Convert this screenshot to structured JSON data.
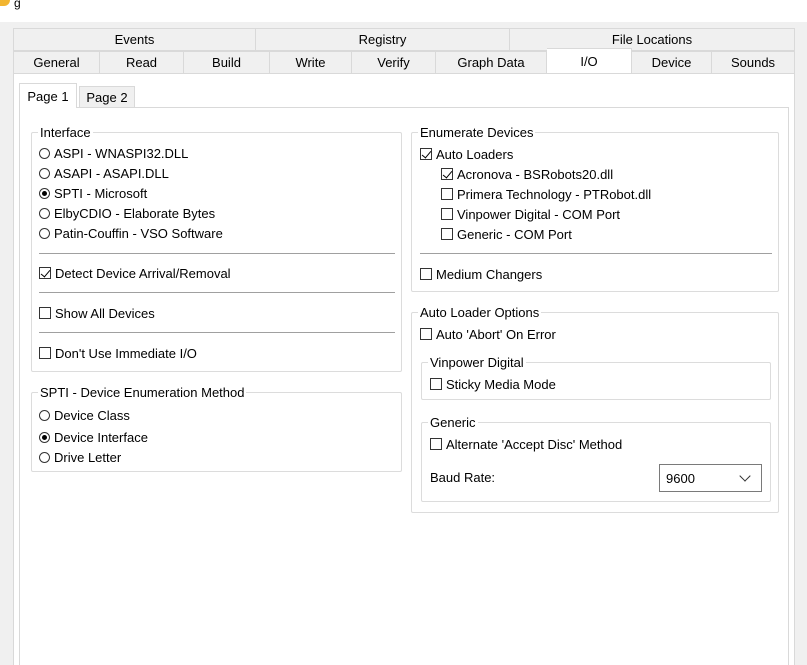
{
  "window": {
    "title_fragment": "g"
  },
  "tabs": {
    "row1": [
      "Events",
      "Registry",
      "File Locations"
    ],
    "row2": [
      "General",
      "Read",
      "Build",
      "Write",
      "Verify",
      "Graph Data",
      "I/O",
      "Device",
      "Sounds"
    ],
    "active": "I/O"
  },
  "subtabs": {
    "page1": "Page 1",
    "page2": "Page 2"
  },
  "interface": {
    "title": "Interface",
    "options": [
      {
        "label": "ASPI - WNASPI32.DLL",
        "selected": false
      },
      {
        "label": "ASAPI - ASAPI.DLL",
        "selected": false
      },
      {
        "label": "SPTI - Microsoft",
        "selected": true
      },
      {
        "label": "ElbyCDIO - Elaborate Bytes",
        "selected": false
      },
      {
        "label": "Patin-Couffin - VSO Software",
        "selected": false
      }
    ],
    "detect_arrival": {
      "label": "Detect Device Arrival/Removal",
      "checked": true
    },
    "show_all": {
      "label": "Show All Devices",
      "checked": false
    },
    "dont_use_immediate": {
      "label": "Don't Use Immediate I/O",
      "checked": false
    }
  },
  "spti": {
    "title": "SPTI - Device Enumeration Method",
    "options": [
      {
        "label": "Device Class",
        "selected": false
      },
      {
        "label": "Device Interface",
        "selected": true
      },
      {
        "label": "Drive Letter",
        "selected": false
      }
    ]
  },
  "enumerate": {
    "title": "Enumerate Devices",
    "auto_loaders": {
      "label": "Auto Loaders",
      "checked": true
    },
    "loaders": [
      {
        "label": "Acronova - BSRobots20.dll",
        "checked": true
      },
      {
        "label": "Primera Technology - PTRobot.dll",
        "checked": false
      },
      {
        "label": "Vinpower Digital - COM Port",
        "checked": false
      },
      {
        "label": "Generic - COM Port",
        "checked": false
      }
    ],
    "medium_changers": {
      "label": "Medium Changers",
      "checked": false
    }
  },
  "autoloader_options": {
    "title": "Auto Loader Options",
    "auto_abort": {
      "label": "Auto 'Abort' On Error",
      "checked": false
    },
    "vinpower": {
      "title": "Vinpower Digital",
      "sticky": {
        "label": "Sticky Media Mode",
        "checked": false
      }
    },
    "generic": {
      "title": "Generic",
      "alternate": {
        "label": "Alternate 'Accept Disc' Method",
        "checked": false
      },
      "baud_label": "Baud Rate:",
      "baud_value": "9600"
    }
  }
}
